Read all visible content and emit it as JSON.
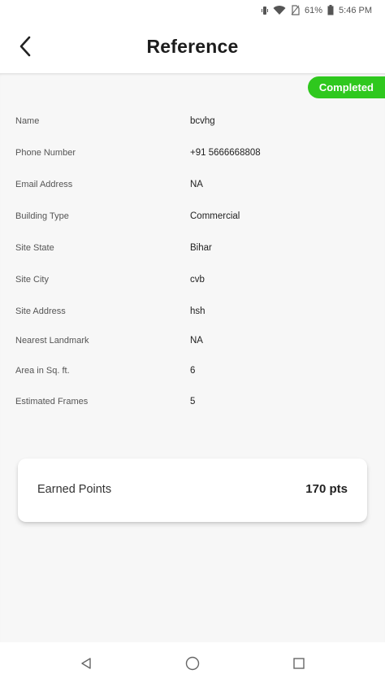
{
  "status_bar": {
    "battery_percent": "61%",
    "time": "5:46 PM",
    "icons": [
      "vibrate-icon",
      "wifi-icon",
      "no-sim-icon",
      "battery-icon"
    ]
  },
  "header": {
    "title": "Reference",
    "back_icon": "back-arrow-icon"
  },
  "status_badge": "Completed",
  "colors": {
    "badge_green": "#2fc81e",
    "background": "#f7f7f7",
    "card": "#ffffff"
  },
  "details": [
    {
      "label": "Name",
      "value": "bcvhg"
    },
    {
      "label": "Phone Number",
      "value": "+91 5666668808"
    },
    {
      "label": "Email Address",
      "value": "NA"
    },
    {
      "label": "Building Type",
      "value": "Commercial"
    },
    {
      "label": "Site State",
      "value": "Bihar"
    },
    {
      "label": "Site City",
      "value": "cvb"
    },
    {
      "label": "Site Address",
      "value": "hsh"
    },
    {
      "label": "Nearest Landmark",
      "value": "NA"
    },
    {
      "label": "Area in Sq. ft.",
      "value": "6"
    },
    {
      "label": "Estimated Frames",
      "value": "5"
    }
  ],
  "points_card": {
    "label": "Earned Points",
    "value": "170 pts"
  },
  "nav_bar": {
    "icons": [
      "back-triangle-icon",
      "home-circle-icon",
      "recents-square-icon"
    ]
  }
}
